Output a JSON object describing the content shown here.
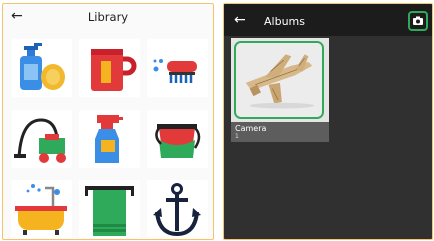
{
  "library": {
    "title": "Library",
    "back_icon": "arrow-left-icon",
    "items": [
      {
        "icon": "dish-soap-icon"
      },
      {
        "icon": "mug-icon"
      },
      {
        "icon": "scrub-brush-icon"
      },
      {
        "icon": "vacuum-cleaner-icon"
      },
      {
        "icon": "spray-bottle-icon"
      },
      {
        "icon": "teapot-icon"
      },
      {
        "icon": "bathtub-icon"
      },
      {
        "icon": "towel-icon"
      },
      {
        "icon": "anchor-icon"
      }
    ]
  },
  "albums": {
    "title": "Albums",
    "back_icon": "arrow-left-icon",
    "camera_icon": "camera-icon",
    "accent_color": "#2faa5a",
    "list": [
      {
        "name": "Camera",
        "count": "1",
        "thumbnail": "airplane-model-photo"
      }
    ]
  },
  "colors": {
    "panel_border": "#f3c56b",
    "albums_background": "#303030",
    "albums_header": "#1c1c1c"
  }
}
